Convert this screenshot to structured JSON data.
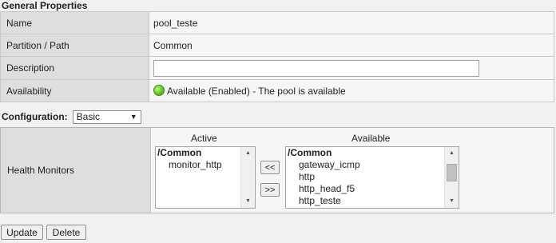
{
  "section_title": "General Properties",
  "properties": {
    "name_label": "Name",
    "name_value": "pool_teste",
    "partition_label": "Partition / Path",
    "partition_value": "Common",
    "description_label": "Description",
    "description_value": "",
    "availability_label": "Availability",
    "availability_value": "Available (Enabled) - The pool is available",
    "availability_status_color": "#5cbf22"
  },
  "configuration": {
    "label": "Configuration:",
    "selected": "Basic",
    "dropdown_icon": "triangle-down-icon"
  },
  "health_monitors": {
    "label": "Health Monitors",
    "active_heading": "Active",
    "available_heading": "Available",
    "active_items": [
      {
        "label": "/Common",
        "group": true
      },
      {
        "label": "monitor_http",
        "group": false
      }
    ],
    "available_items": [
      {
        "label": "/Common",
        "group": true
      },
      {
        "label": "gateway_icmp",
        "group": false
      },
      {
        "label": "http",
        "group": false
      },
      {
        "label": "http_head_f5",
        "group": false
      },
      {
        "label": "http_teste",
        "group": false
      }
    ],
    "move_left_label": "<<",
    "move_right_label": ">>"
  },
  "actions": {
    "update_label": "Update",
    "delete_label": "Delete"
  }
}
